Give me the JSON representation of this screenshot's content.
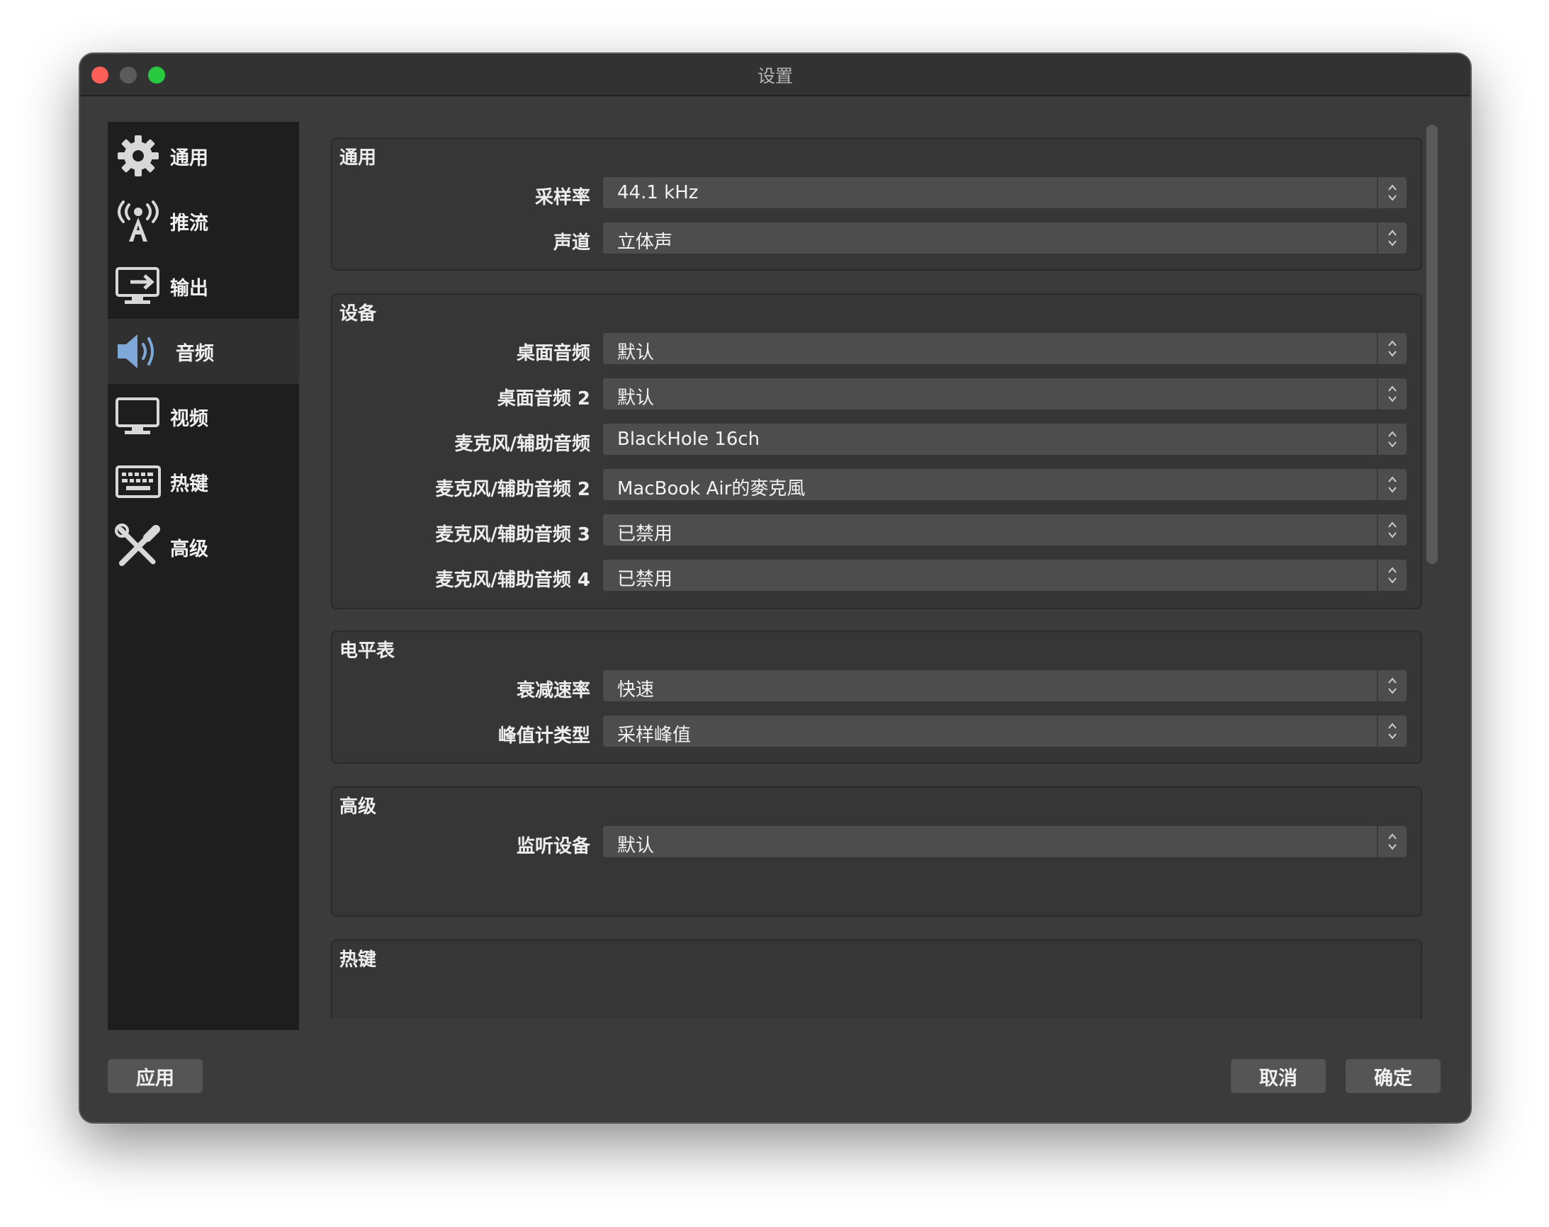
{
  "window": {
    "title": "设置"
  },
  "sidebar": {
    "items": [
      {
        "label": "通用",
        "icon": "gear-icon"
      },
      {
        "label": "推流",
        "icon": "antenna-icon"
      },
      {
        "label": "输出",
        "icon": "output-monitor-icon"
      },
      {
        "label": "音频",
        "icon": "speaker-icon",
        "active": true
      },
      {
        "label": "视频",
        "icon": "monitor-icon"
      },
      {
        "label": "热键",
        "icon": "keyboard-icon"
      },
      {
        "label": "高级",
        "icon": "tools-icon"
      }
    ]
  },
  "groups": {
    "general": {
      "title": "通用",
      "rows": [
        {
          "label": "采样率",
          "value": "44.1 kHz"
        },
        {
          "label": "声道",
          "value": "立体声"
        }
      ]
    },
    "devices": {
      "title": "设备",
      "rows": [
        {
          "label": "桌面音频",
          "value": "默认"
        },
        {
          "label": "桌面音频 2",
          "value": "默认"
        },
        {
          "label": "麦克风/辅助音频",
          "value": "BlackHole 16ch"
        },
        {
          "label": "麦克风/辅助音频 2",
          "value": "MacBook Air的麥克風"
        },
        {
          "label": "麦克风/辅助音频 3",
          "value": "已禁用"
        },
        {
          "label": "麦克风/辅助音频 4",
          "value": "已禁用"
        }
      ]
    },
    "meters": {
      "title": "电平表",
      "rows": [
        {
          "label": "衰减速率",
          "value": "快速"
        },
        {
          "label": "峰值计类型",
          "value": "采样峰值"
        }
      ]
    },
    "advanced": {
      "title": "高级",
      "rows": [
        {
          "label": "监听设备",
          "value": "默认"
        }
      ]
    },
    "hotkeys": {
      "title": "热键"
    }
  },
  "buttons": {
    "apply": "应用",
    "cancel": "取消",
    "ok": "确定"
  }
}
